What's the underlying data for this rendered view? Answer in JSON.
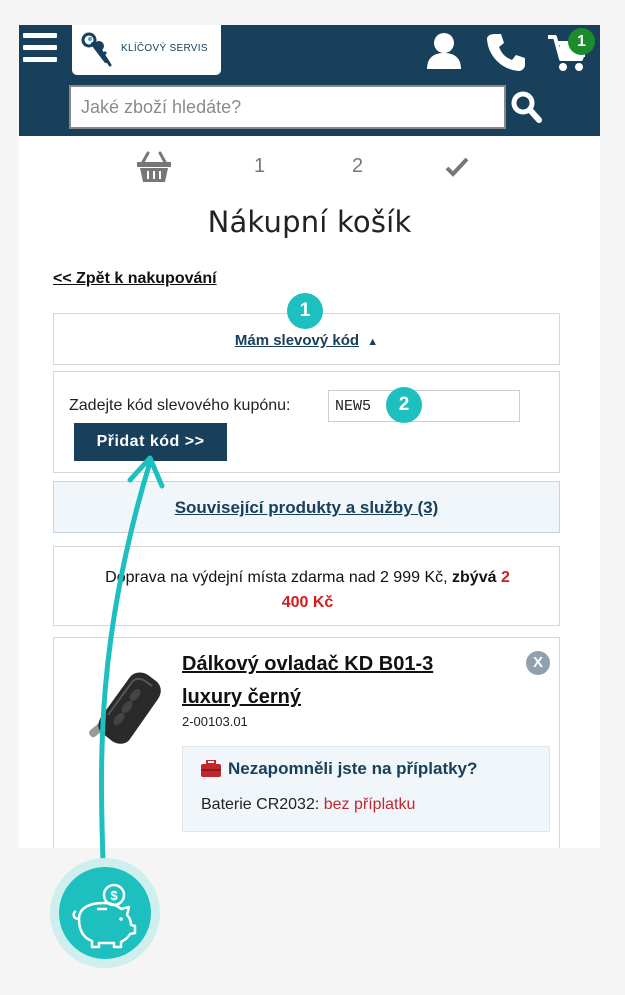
{
  "header": {
    "logo_text": "KLÍČOVÝ SERVIS",
    "cart_count": "1",
    "search_placeholder": "Jaké zboží hledáte?",
    "bg_color": "#18405a"
  },
  "steps": {
    "items": [
      "1",
      "2"
    ],
    "icons": [
      "basket-icon",
      "checkmark-icon"
    ]
  },
  "page": {
    "title": "Nákupní košík",
    "back_link": "<< Zpět k nakupování"
  },
  "discount": {
    "toggle_label": "Mám slevový kód",
    "toggle_arrow": "▲",
    "coupon_label": "Zadejte kód slevového kupónu:",
    "coupon_value": "NEW5",
    "submit_label": "Přidat kód >>"
  },
  "related": {
    "label": "Související produkty a služby (3)"
  },
  "shipping": {
    "text": "Doprava na výdejní místa zdarma nad 2 999 Kč,",
    "remaining_label": "zbývá",
    "remaining_amount_part1": "2",
    "remaining_amount_part2": "400 Kč"
  },
  "product": {
    "name": "Dálkový ovladač KD B01-3 luxury černý",
    "code": "2-00103.01",
    "remove_label": "X",
    "upsell_title": "Nezapomněli jste na příplatky?",
    "upsell_item_name": "Baterie CR2032:",
    "upsell_item_value": "bez příplatku"
  },
  "annotations": {
    "step1": "1",
    "step2": "2",
    "accent_color": "#1dbfbf",
    "piggy_coin_symbol": "$"
  }
}
